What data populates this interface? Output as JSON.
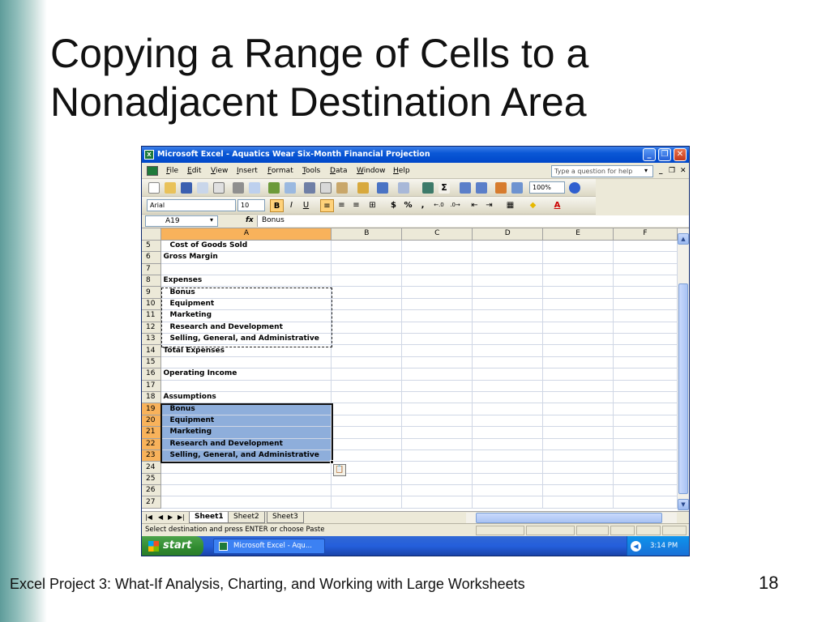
{
  "slide": {
    "title_line1": "Copying a Range of Cells to a",
    "title_line2": "Nonadjacent Destination Area",
    "footer": "Excel Project 3: What-If Analysis, Charting, and Working with  Large Worksheets",
    "page_number": "18"
  },
  "excel": {
    "window_title": "Microsoft Excel - Aquatics Wear Six-Month Financial Projection",
    "menu": [
      "File",
      "Edit",
      "View",
      "Insert",
      "Format",
      "Tools",
      "Data",
      "Window",
      "Help"
    ],
    "help_placeholder": "Type a question for help",
    "zoom": "100%",
    "font_name": "Arial",
    "font_size": "10",
    "bold_label": "B",
    "italic_label": "I",
    "underline_label": "U",
    "currency_label": "$",
    "percent_label": "%",
    "comma_label": ",",
    "name_box": "A19",
    "fx_label": "fx",
    "formula_value": "Bonus",
    "columns": [
      "A",
      "B",
      "C",
      "D",
      "E",
      "F"
    ],
    "rows": [
      {
        "num": "5",
        "a": "Cost of Goods Sold",
        "indent": true
      },
      {
        "num": "6",
        "a": "Gross Margin",
        "indent": false
      },
      {
        "num": "7",
        "a": "",
        "indent": false
      },
      {
        "num": "8",
        "a": "Expenses",
        "indent": false
      },
      {
        "num": "9",
        "a": "Bonus",
        "indent": true
      },
      {
        "num": "10",
        "a": "Equipment",
        "indent": true
      },
      {
        "num": "11",
        "a": "Marketing",
        "indent": true
      },
      {
        "num": "12",
        "a": "Research and Development",
        "indent": true
      },
      {
        "num": "13",
        "a": "Selling, General, and Administrative",
        "indent": true
      },
      {
        "num": "14",
        "a": "Total Expenses",
        "indent": false
      },
      {
        "num": "15",
        "a": "",
        "indent": false
      },
      {
        "num": "16",
        "a": "Operating Income",
        "indent": false
      },
      {
        "num": "17",
        "a": "",
        "indent": false
      },
      {
        "num": "18",
        "a": "Assumptions",
        "indent": false
      },
      {
        "num": "19",
        "a": "Bonus",
        "indent": true
      },
      {
        "num": "20",
        "a": "Equipment",
        "indent": true
      },
      {
        "num": "21",
        "a": "Marketing",
        "indent": true
      },
      {
        "num": "22",
        "a": "Research and Development",
        "indent": true
      },
      {
        "num": "23",
        "a": "Selling, General, and Administrative",
        "indent": true
      },
      {
        "num": "24",
        "a": "",
        "indent": false
      },
      {
        "num": "25",
        "a": "",
        "indent": false
      },
      {
        "num": "26",
        "a": "",
        "indent": false
      },
      {
        "num": "27",
        "a": "",
        "indent": false
      }
    ],
    "sheet_tabs": [
      "Sheet1",
      "Sheet2",
      "Sheet3"
    ],
    "active_sheet": "Sheet1",
    "status_text": "Select destination and press ENTER or choose Paste",
    "start_label": "start",
    "task_item": "Microsoft Excel - Aqu...",
    "clock": "3:14 PM",
    "colors": {
      "selection": "#8eaedb",
      "active_header": "#f8b25b",
      "titlebar": "#0a58d6",
      "start_button": "#2f8a2f"
    }
  }
}
